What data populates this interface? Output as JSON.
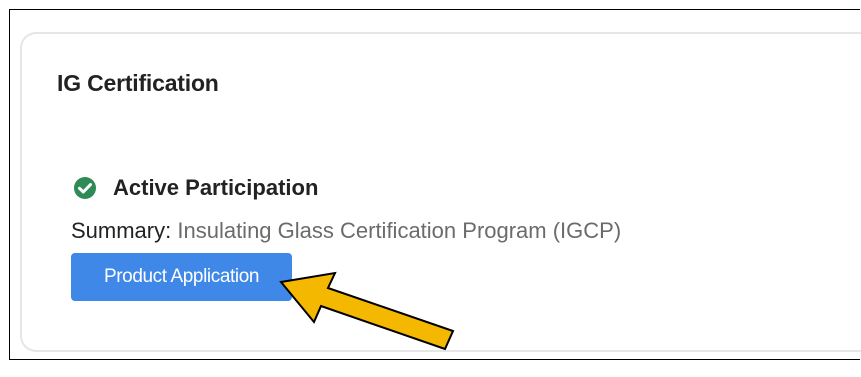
{
  "card": {
    "title": "IG Certification"
  },
  "status": {
    "icon": "check-circle-icon",
    "icon_color": "#2e8b57",
    "label": "Active Participation"
  },
  "summary": {
    "label": "Summary",
    "separator": ": ",
    "value": "Insulating Glass Certification Program (IGCP)"
  },
  "actions": {
    "product_application_label": "Product Application",
    "button_color": "#3f88e8"
  },
  "annotation": {
    "arrow_icon": "pointer-arrow-icon",
    "arrow_color": "#f5b800"
  }
}
